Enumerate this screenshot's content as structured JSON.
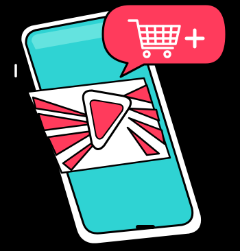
{
  "illustration": {
    "subject": "phone-with-play-button-and-add-to-cart-bubble",
    "icons": [
      "phone-icon",
      "play-icon",
      "shopping-cart-icon",
      "plus-icon",
      "speech-bubble-icon"
    ],
    "colors": {
      "background": "#000000",
      "screen": "#2fd3d3",
      "accent": "#ff3b5c",
      "outline": "#000000",
      "frame": "#ffffff",
      "screen_top_highlight": "#8ff0ea"
    }
  }
}
